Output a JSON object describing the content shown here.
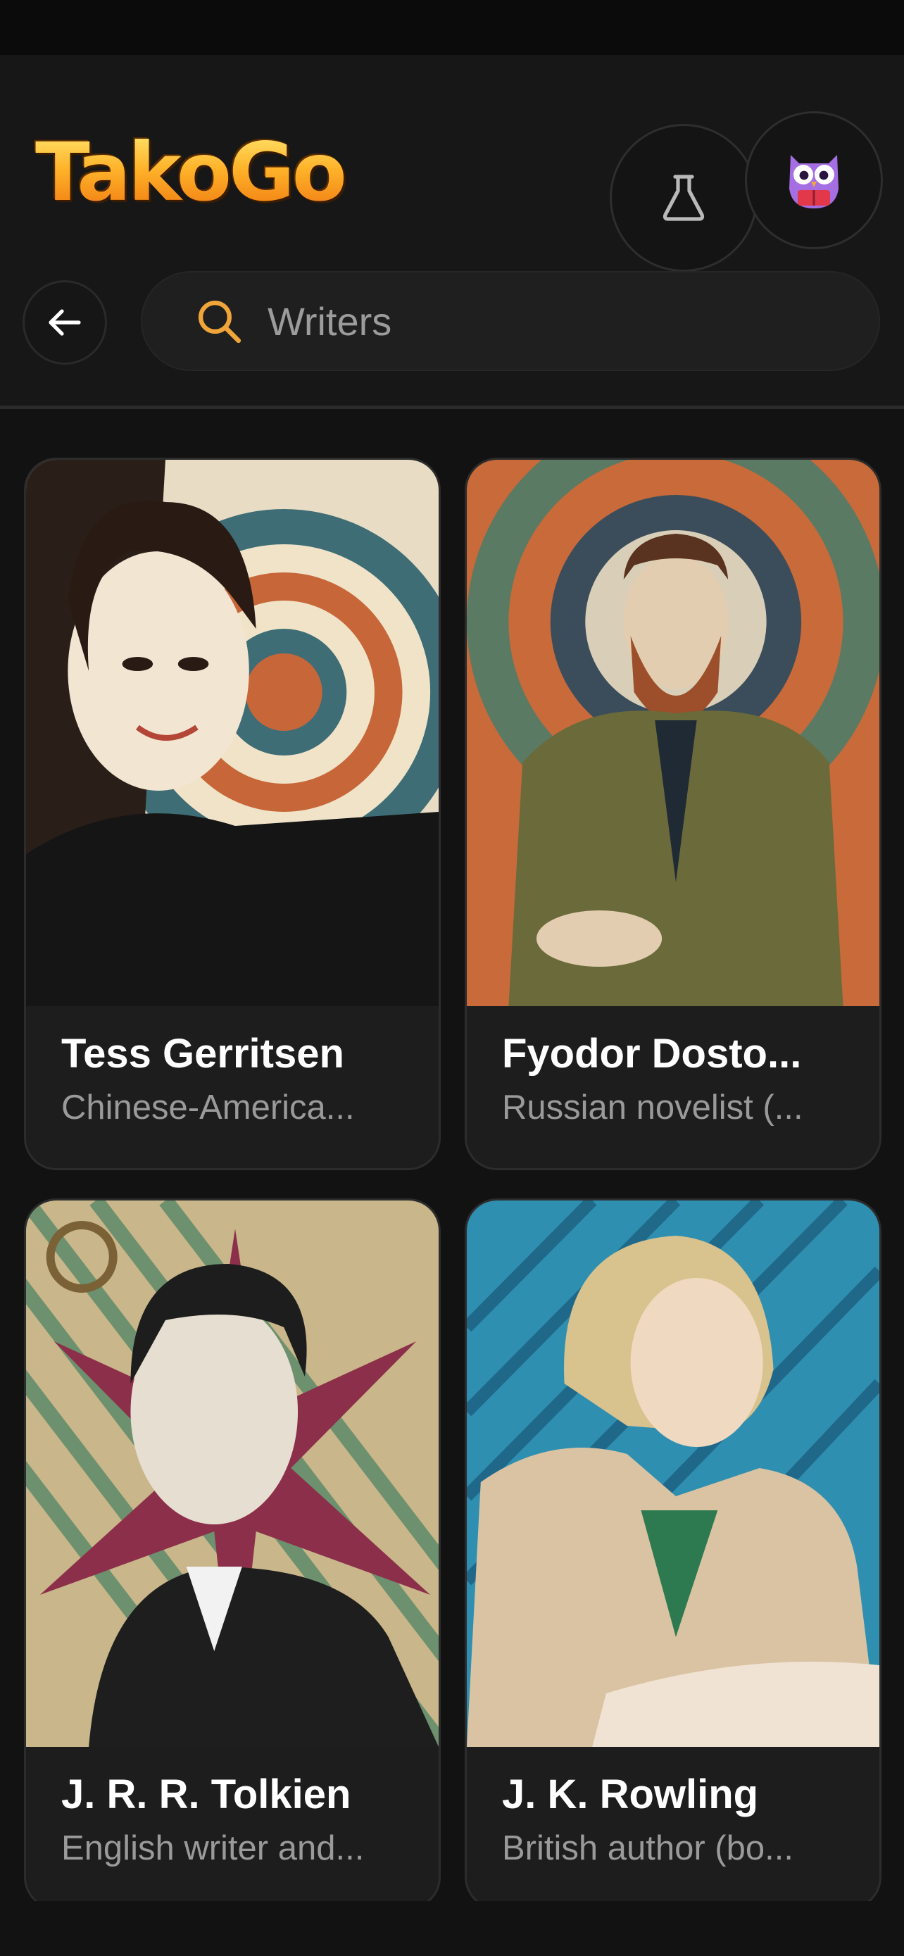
{
  "app": {
    "logo_text": "TakoGo"
  },
  "header": {
    "lab_button_icon": "flask-icon",
    "profile_icon": "owl-reading-icon"
  },
  "search": {
    "placeholder": "Writers",
    "icon": "search-icon",
    "back_icon": "arrow-left-icon"
  },
  "colors": {
    "accent": "#f0a53a",
    "background": "#121212",
    "card": "#1d1d1d"
  },
  "cards": [
    {
      "name": "Tess Gerritsen",
      "description": "Chinese-America..."
    },
    {
      "name": "Fyodor Dosto...",
      "description": "Russian novelist (..."
    },
    {
      "name": "J. R. R. Tolkien",
      "description": "English writer and..."
    },
    {
      "name": "J. K. Rowling",
      "description": "British author (bo..."
    }
  ]
}
